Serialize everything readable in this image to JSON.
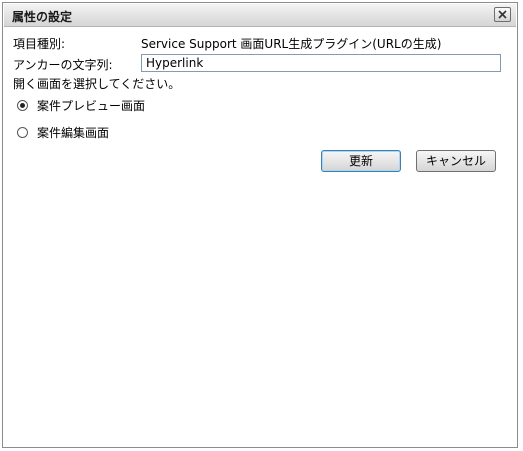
{
  "dialog": {
    "title": "属性の設定",
    "close_symbol": "✕"
  },
  "form": {
    "item_type_label": "項目種別:",
    "item_type_value": "Service Support 画面URL生成プラグイン(URLの生成)",
    "anchor_label": "アンカーの文字列:",
    "anchor_value": "Hyperlink",
    "screen_prompt": "開く画面を選択してください。",
    "options": [
      {
        "label": "案件プレビュー画面",
        "selected": true
      },
      {
        "label": "案件編集画面",
        "selected": false
      }
    ]
  },
  "buttons": {
    "update_label": "更新",
    "cancel_label": "キャンセル"
  },
  "icons": {
    "close": "close-icon"
  }
}
